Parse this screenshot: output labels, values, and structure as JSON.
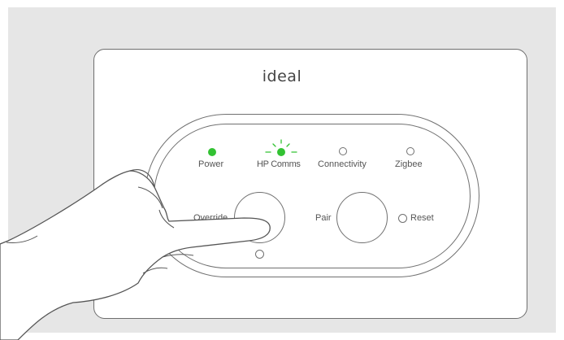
{
  "device": {
    "brand": "ideal",
    "indicators": [
      {
        "label": "Power",
        "state": "on",
        "color": "#33c233"
      },
      {
        "label": "HP Comms",
        "state": "flashing",
        "color": "#33c233"
      },
      {
        "label": "Connectivity",
        "state": "off"
      },
      {
        "label": "Zigbee",
        "state": "off"
      }
    ],
    "buttons": {
      "override_label": "Override",
      "pair_label": "Pair",
      "reset_label": "Reset"
    }
  },
  "colors": {
    "led_green": "#33c233",
    "outline": "#707070",
    "background": "#e6e6e6"
  }
}
